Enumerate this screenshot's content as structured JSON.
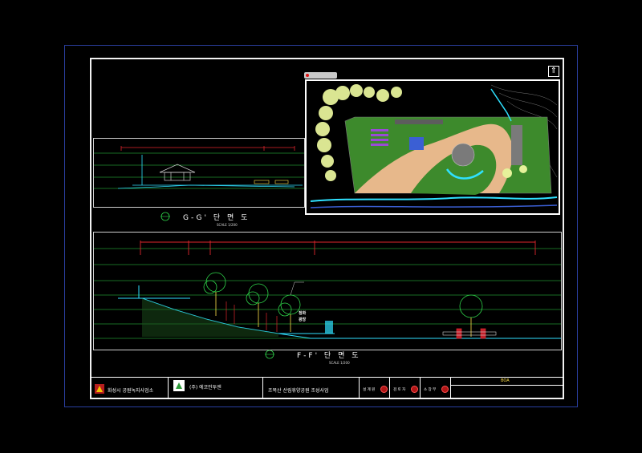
{
  "drawing": {
    "section_gg_label": "G-G' 단 면 도",
    "section_ff_label": "F-F' 단 면 도",
    "scale_note_gg": "SCALE 1/200",
    "scale_note_ff": "SCALE 1/200",
    "inset_tag": "",
    "north_symbol": "⇑",
    "annotations": [
      "정화",
      "광장"
    ]
  },
  "title_block": {
    "client_name": "화성시 공원녹지사업소",
    "firm_name": "(주) 에코인투엔",
    "project_name": "조목산 산림휴양공원 조성사업",
    "reviewers": [
      "설 계 원",
      "검 토 자",
      "소 장 부"
    ],
    "sheet_title": "BOA",
    "sheet_no": ""
  },
  "colors": {
    "frame": "#f2f2f2",
    "outer_border": "#2a3fa0",
    "grid_line": "#2fd64a",
    "dim_line": "#e0262c",
    "cyan": "#2fe1ff",
    "inset_green": "#3d8a2c",
    "inset_path": "#e7b88b",
    "inset_tree": "#e6f29a"
  }
}
